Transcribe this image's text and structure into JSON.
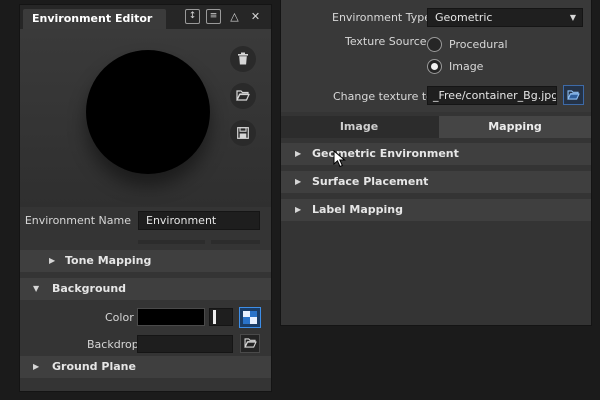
{
  "editor": {
    "title": "Environment Editor",
    "title_icons": [
      "swap-icon",
      "list-icon",
      "collapse-icon",
      "close-icon"
    ],
    "preview_actions": [
      "trash-icon",
      "folder-icon",
      "save-icon"
    ],
    "environment_name_label": "Environment Name",
    "environment_name_value": "Environment",
    "sections": {
      "tone_mapping": "Tone Mapping",
      "background": "Background",
      "ground_plane": "Ground Plane"
    },
    "background": {
      "color_label": "Color",
      "color_value": "#000000",
      "backdrop_label": "Backdrop",
      "backdrop_value": ""
    }
  },
  "texture": {
    "environment_type_label": "Environment Type",
    "environment_type_value": "Geometric",
    "texture_source_label": "Texture Source",
    "source_options": [
      {
        "label": "Procedural",
        "selected": false
      },
      {
        "label": "Image",
        "selected": true
      }
    ],
    "change_texture_label": "Change texture to",
    "change_texture_value": "_Free/container_Bg.jpg"
  },
  "tabs": [
    {
      "label": "Image",
      "active": false
    },
    {
      "label": "Mapping",
      "active": true
    }
  ],
  "mapping_sections": [
    "Geometric Environment",
    "Surface Placement",
    "Label Mapping"
  ],
  "colors": {
    "accent": "#3d8ee8",
    "panel": "#343434",
    "background": "#1b1b1b"
  }
}
